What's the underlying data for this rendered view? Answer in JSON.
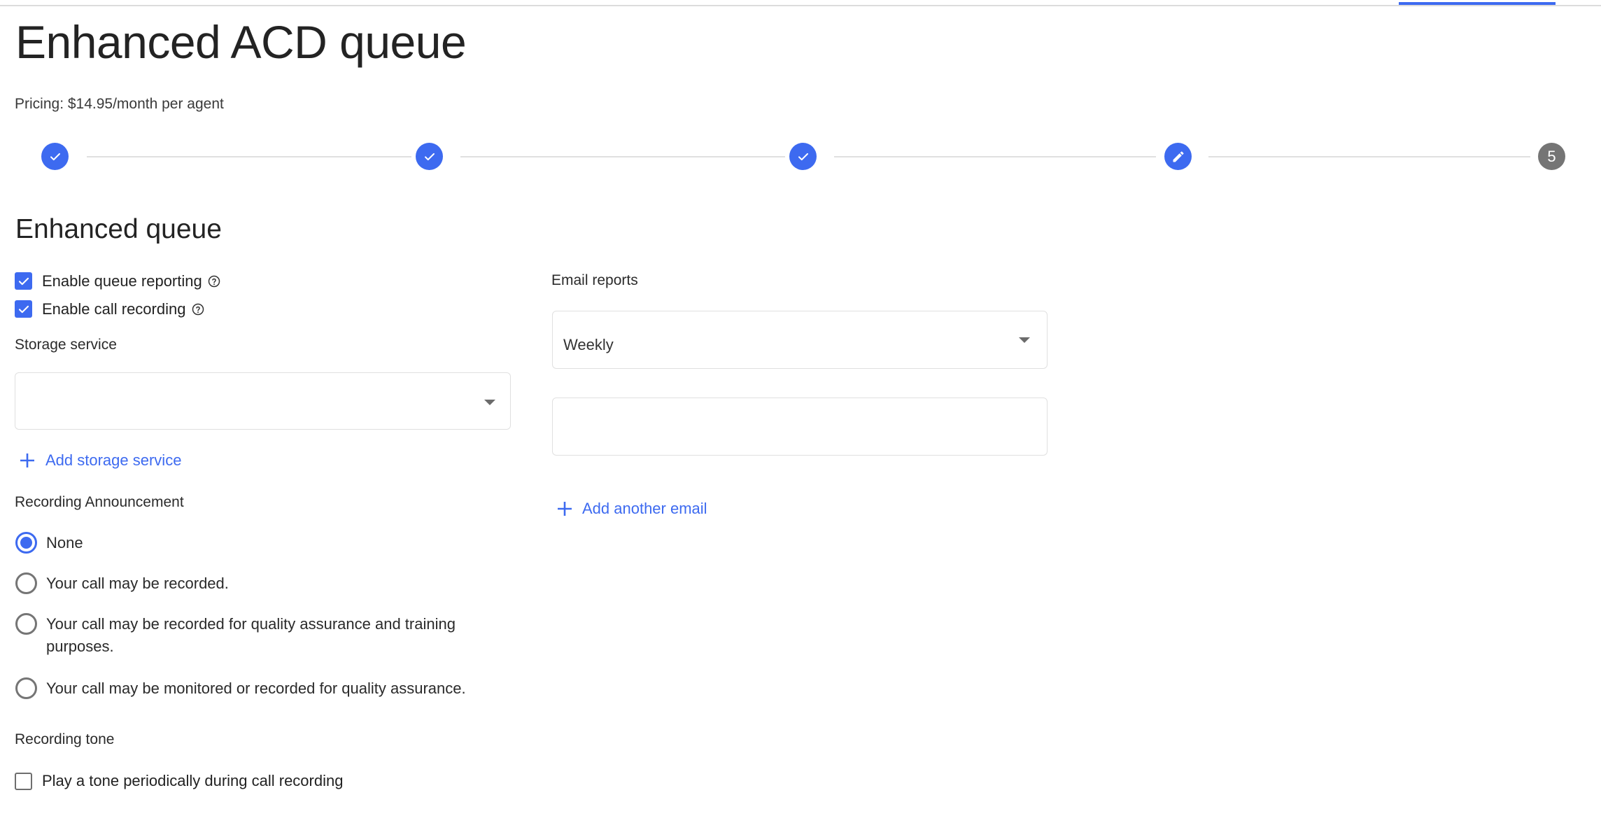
{
  "page": {
    "title": "Enhanced ACD queue",
    "pricing": "Pricing: $14.95/month per agent"
  },
  "colors": {
    "accent": "#3d6af0",
    "pending_step": "#757575",
    "divider": "#e0e0e0"
  },
  "stepper": {
    "steps": [
      {
        "state": "complete",
        "icon": "check-icon"
      },
      {
        "state": "complete",
        "icon": "check-icon"
      },
      {
        "state": "complete",
        "icon": "check-icon"
      },
      {
        "state": "current",
        "icon": "pencil-icon"
      },
      {
        "state": "pending",
        "label": "5"
      }
    ]
  },
  "section": {
    "heading": "Enhanced queue",
    "checkboxes": [
      {
        "label": "Enable queue reporting",
        "checked": true,
        "help_icon": "help-circle-icon"
      },
      {
        "label": "Enable call recording",
        "checked": true,
        "help_icon": "help-circle-icon"
      }
    ],
    "storage": {
      "label": "Storage service",
      "value": "",
      "add_link": "Add storage service"
    },
    "announcement": {
      "label": "Recording Announcement",
      "options": [
        {
          "label": "None",
          "selected": true
        },
        {
          "label": "Your call may be recorded.",
          "selected": false
        },
        {
          "label": "Your call may be recorded for quality assurance and training purposes.",
          "selected": false
        },
        {
          "label": "Your call may be monitored or recorded for quality assurance.",
          "selected": false
        }
      ]
    },
    "tone": {
      "label": "Recording tone",
      "checkbox_label": "Play a tone periodically during call recording",
      "checked": false
    },
    "email_reports": {
      "label": "Email reports",
      "frequency": "Weekly",
      "email_value": "",
      "add_link": "Add another email"
    }
  }
}
